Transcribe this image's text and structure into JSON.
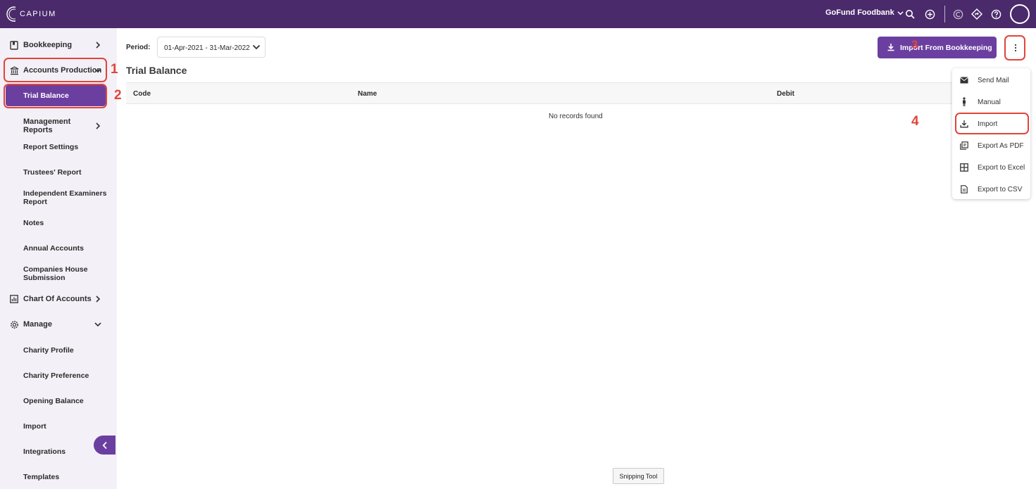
{
  "brand": {
    "logo_text": "CAPIUM"
  },
  "header": {
    "org_name": "GoFund Foodbank"
  },
  "sidebar": {
    "bookkeeping": "Bookkeeping",
    "accounts_production": "Accounts Production",
    "sub_items": {
      "trial_balance": "Trial Balance",
      "management_reports": "Management Reports",
      "report_settings": "Report Settings",
      "trustees_report": "Trustees' Report",
      "independent_examiners_report": "Independent Examiners Report",
      "notes": "Notes",
      "annual_accounts": "Annual Accounts",
      "companies_house_submission": "Companies House Submission"
    },
    "chart_of_accounts": "Chart Of Accounts",
    "manage": "Manage",
    "manage_items": {
      "charity_profile": "Charity Profile",
      "charity_preference": "Charity Preference",
      "opening_balance": "Opening Balance",
      "import": "Import",
      "integrations": "Integrations",
      "templates": "Templates"
    }
  },
  "annotations": {
    "a1": "1",
    "a2": "2",
    "a3": "3",
    "a4": "4"
  },
  "main": {
    "period_label": "Period:",
    "period_value": "01-Apr-2021 - 31-Mar-2022",
    "title": "Trial Balance",
    "import_button": "Import From Bookkeeping",
    "columns": {
      "code": "Code",
      "name": "Name",
      "debit": "Debit"
    },
    "empty_message": "No records found"
  },
  "menu": {
    "send_mail": "Send Mail",
    "manual": "Manual",
    "import": "Import",
    "export_pdf": "Export As PDF",
    "export_excel": "Export to Excel",
    "export_csv": "Export to CSV"
  },
  "tooltip": "Snipping Tool",
  "colors": {
    "topbar": "#4a2a6b",
    "accent": "#6b3fa0",
    "highlight": "#e0453a",
    "sidebar_bg": "#f4f0f7"
  }
}
